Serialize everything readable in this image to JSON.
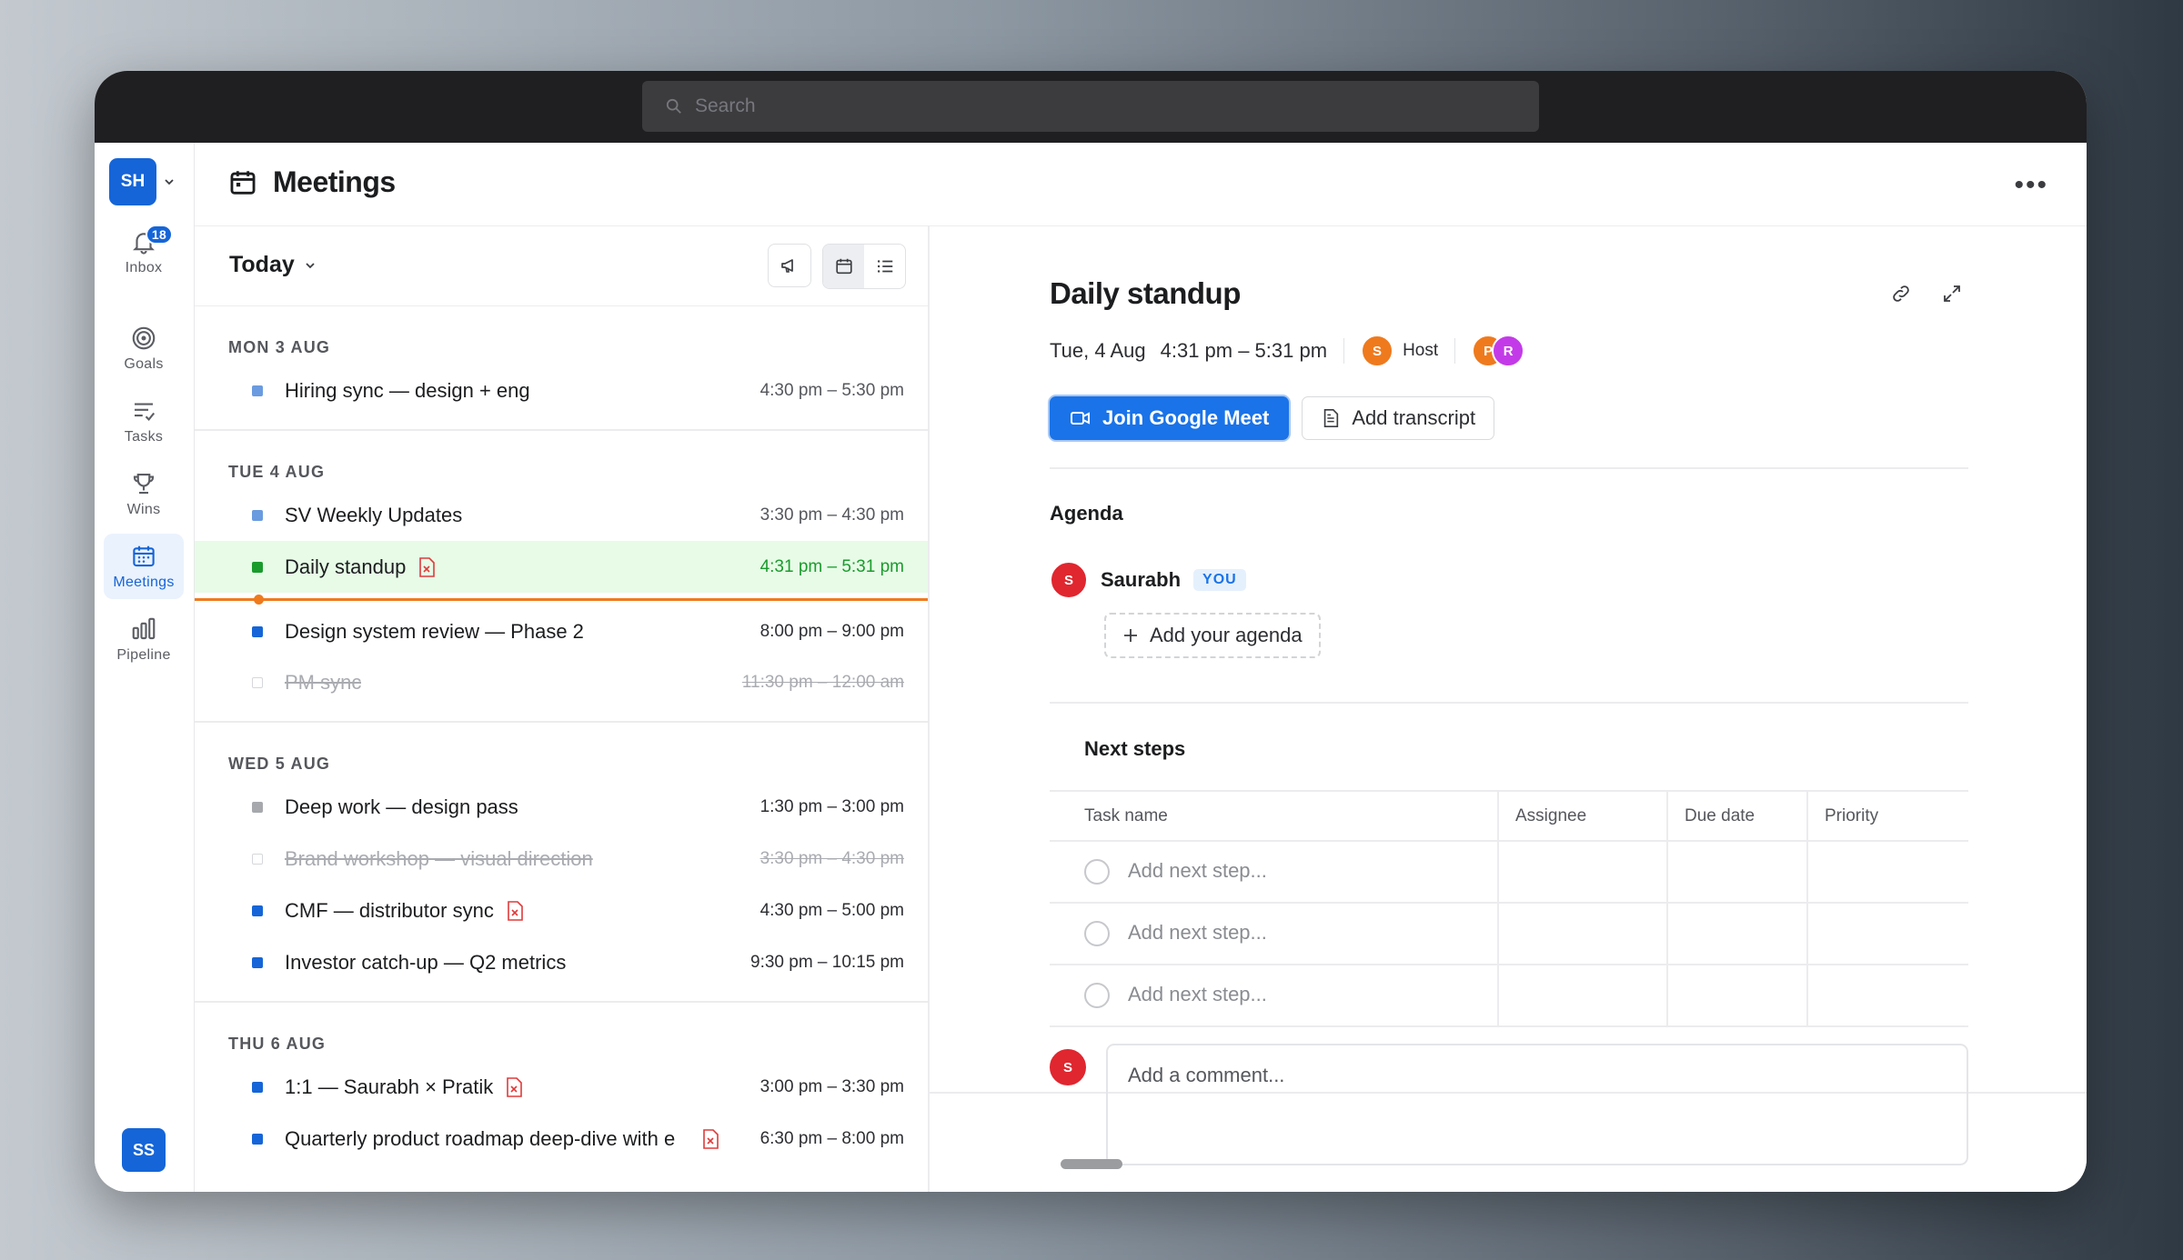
{
  "search": {
    "placeholder": "Search"
  },
  "sidebar": {
    "workspace": "SH",
    "items": [
      {
        "label": "Inbox",
        "badge": "18"
      },
      {
        "label": "Goals"
      },
      {
        "label": "Tasks"
      },
      {
        "label": "Wins"
      },
      {
        "label": "Meetings"
      },
      {
        "label": "Pipeline"
      }
    ],
    "user": "SS"
  },
  "header": {
    "title": "Meetings"
  },
  "list": {
    "range": "Today",
    "days": [
      {
        "label": "MON 3 AUG",
        "events": [
          {
            "name": "Hiring sync — design + eng",
            "time": "4:30 pm – 5:30 pm"
          }
        ]
      },
      {
        "label": "TUE 4 AUG",
        "events": [
          {
            "name": "SV Weekly Updates",
            "time": "3:30 pm – 4:30 pm"
          },
          {
            "name": "Daily standup",
            "time": "4:31 pm – 5:31 pm"
          },
          {
            "name": "Design system review — Phase 2",
            "time": "8:00 pm – 9:00 pm"
          },
          {
            "name": "PM sync",
            "time": "11:30 pm – 12:00 am"
          }
        ]
      },
      {
        "label": "WED 5 AUG",
        "events": [
          {
            "name": "Deep work — design pass",
            "time": "1:30 pm – 3:00 pm"
          },
          {
            "name": "Brand workshop — visual direction",
            "time": "3:30 pm – 4:30 pm"
          },
          {
            "name": "CMF — distributor sync",
            "time": "4:30 pm – 5:00 pm"
          },
          {
            "name": "Investor catch-up — Q2 metrics",
            "time": "9:30 pm – 10:15 pm"
          }
        ]
      },
      {
        "label": "THU 6 AUG",
        "events": [
          {
            "name": "1:1 — Saurabh × Pratik",
            "time": "3:00 pm – 3:30 pm"
          },
          {
            "name": "Quarterly product roadmap deep-dive with e",
            "time": "6:30 pm – 8:00 pm"
          }
        ]
      }
    ]
  },
  "detail": {
    "title": "Daily standup",
    "date": "Tue, 4 Aug",
    "time": "4:31 pm – 5:31 pm",
    "host_initial": "S",
    "host_label": "Host",
    "attendees": [
      "P",
      "R"
    ],
    "join_label": "Join Google Meet",
    "transcript_label": "Add transcript",
    "agenda_label": "Agenda",
    "agenda_user_initial": "S",
    "agenda_user": "Saurabh",
    "you_tag": "YOU",
    "add_agenda": "Add your agenda",
    "next_steps": "Next steps",
    "columns": [
      "Task name",
      "Assignee",
      "Due date",
      "Priority"
    ],
    "rows": [
      "Add next step...",
      "Add next step...",
      "Add next step..."
    ],
    "comment_initial": "S",
    "comment_placeholder": "Add a comment..."
  },
  "colors": {
    "accent": "#1565d8",
    "current": "#1a9b2c",
    "now_line": "#ef7a1e",
    "pdf": "#e03a3a"
  }
}
